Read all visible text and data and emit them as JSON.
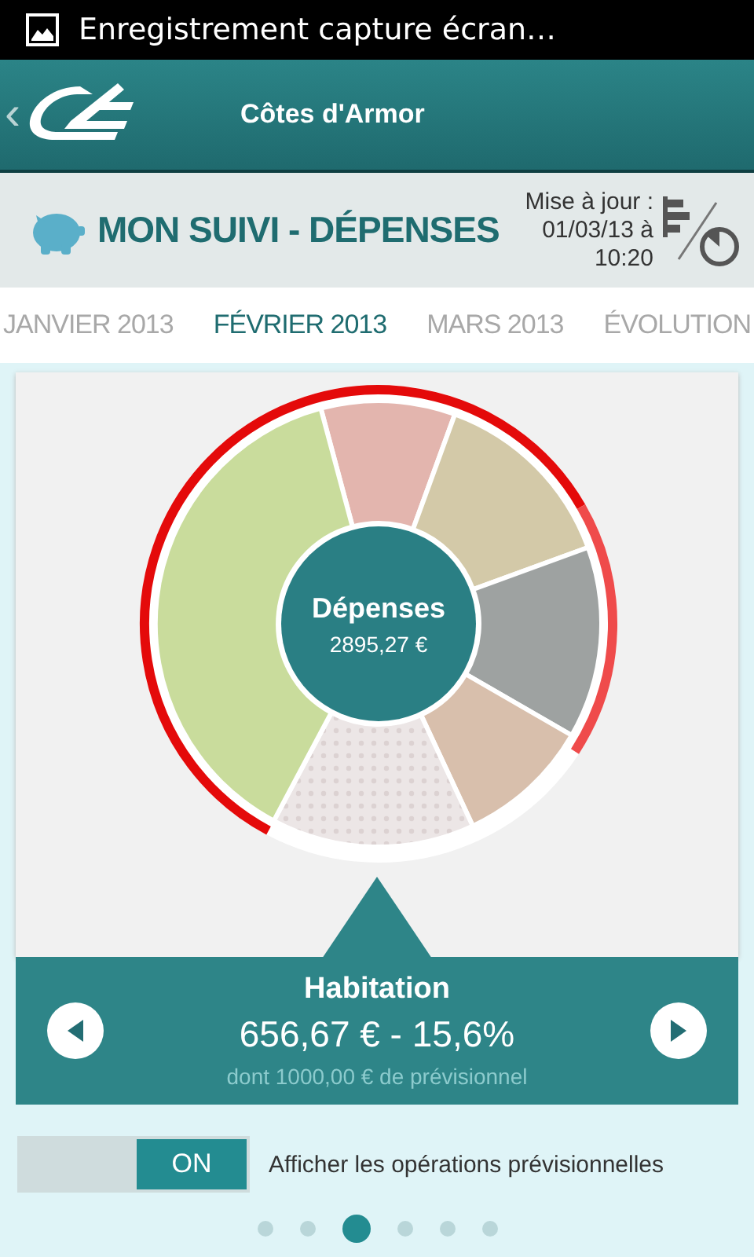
{
  "status_bar": {
    "notification": "Enregistrement capture écran…"
  },
  "header": {
    "back": "‹",
    "title": "Côtes d'Armor"
  },
  "section": {
    "title": "MON SUIVI - DÉPENSES",
    "updated": "Mise à jour :\n01/03/13 à\n10:20"
  },
  "tabs": [
    {
      "label": "JANVIER 2013",
      "selected": false
    },
    {
      "label": "FÉVRIER 2013",
      "selected": true
    },
    {
      "label": "MARS 2013",
      "selected": false
    },
    {
      "label": "ÉVOLUTION",
      "selected": false
    }
  ],
  "chart_center": {
    "label": "Dépenses",
    "total": "2895,27 €"
  },
  "detail": {
    "category": "Habitation",
    "amount": "656,67 € - 15,6%",
    "note": "dont 1000,00 € de prévisionnel"
  },
  "toggle": {
    "on": true,
    "state_label": "ON",
    "label": "Afficher les opérations prévisionnelles"
  },
  "pages": [
    {
      "selected": false
    },
    {
      "selected": false
    },
    {
      "selected": true
    },
    {
      "selected": false
    },
    {
      "selected": false
    },
    {
      "selected": false
    }
  ]
}
